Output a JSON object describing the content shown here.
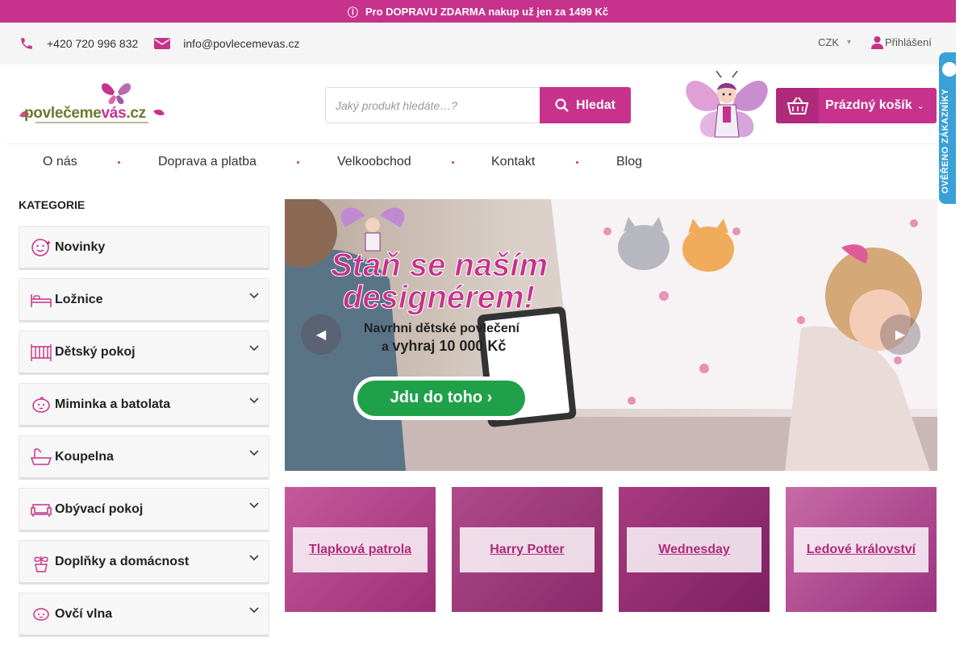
{
  "topbar": {
    "icon": "info-icon",
    "text": "Pro DOPRAVU ZDARMA nakup už jen za 1499 Kč"
  },
  "contact": {
    "phone": "+420 720 996 832",
    "email": "info@povlecemevas.cz",
    "currency": "CZK",
    "login": "Přihlášení"
  },
  "header": {
    "logo_text_a": "povlečeme",
    "logo_text_b": "vás",
    "logo_text_c": ".cz",
    "search_placeholder": "Jaký produkt hledáte…?",
    "search_button": "Hledat",
    "cart_label": "Prázdný košík"
  },
  "nav": [
    "O nás",
    "Doprava a platba",
    "Velkoobchod",
    "Kontakt",
    "Blog"
  ],
  "badge": {
    "text": "OVĚŘENO ZÁKAZNÍKY"
  },
  "sidebar": {
    "title": "KATEGORIE",
    "items": [
      {
        "label": "Novinky",
        "icon": "face-icon",
        "expandable": false
      },
      {
        "label": "Ložnice",
        "icon": "bed-icon",
        "expandable": true
      },
      {
        "label": "Dětský pokoj",
        "icon": "crib-icon",
        "expandable": true
      },
      {
        "label": "Miminka a batolata",
        "icon": "baby-icon",
        "expandable": true
      },
      {
        "label": "Koupelna",
        "icon": "bathtub-icon",
        "expandable": true
      },
      {
        "label": "Obývací pokoj",
        "icon": "sofa-icon",
        "expandable": true
      },
      {
        "label": "Doplňky a domácnost",
        "icon": "plant-icon",
        "expandable": true
      },
      {
        "label": "Ovčí vlna",
        "icon": "sheep-icon",
        "expandable": true
      }
    ]
  },
  "banner": {
    "headline_1": "Staň se naším",
    "headline_2": "designérem!",
    "sub_1": "Navrhni dětské povlečení",
    "sub_2a": "a ",
    "sub_2b": "vyhraj 10 000 Kč",
    "cta": "Jdu do toho  ›"
  },
  "tiles": [
    "Tlapková patrola",
    "Harry Potter",
    "Wednesday",
    "Ledové království"
  ],
  "colors": {
    "brand": "#c6328c",
    "cta_green": "#1fa14a",
    "badge_blue": "#3aa0d8"
  }
}
